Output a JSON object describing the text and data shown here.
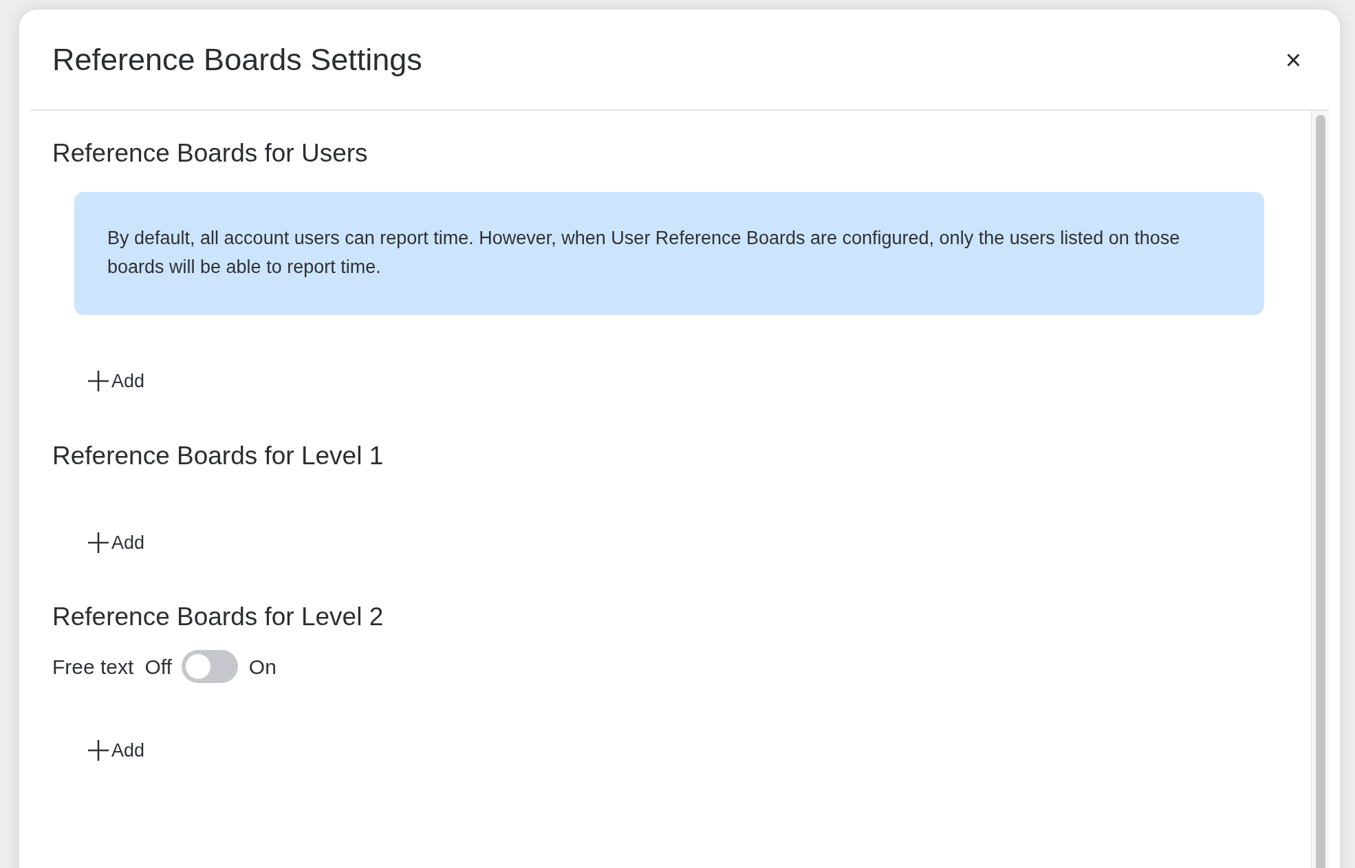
{
  "dialog": {
    "title": "Reference Boards Settings",
    "close": "×"
  },
  "sections": [
    {
      "heading": "Reference Boards for Users",
      "info": "By default, all account users can report time. However, when User Reference Boards are configured, only the users listed on those boards will be able to report time.",
      "add": "Add"
    },
    {
      "heading": "Reference Boards for Level 1",
      "add": "Add"
    },
    {
      "heading": "Reference Boards for Level 2",
      "free_text": {
        "label": "Free text",
        "off_label": "Off",
        "on_label": "On",
        "on": false
      },
      "add": "Add"
    }
  ]
}
